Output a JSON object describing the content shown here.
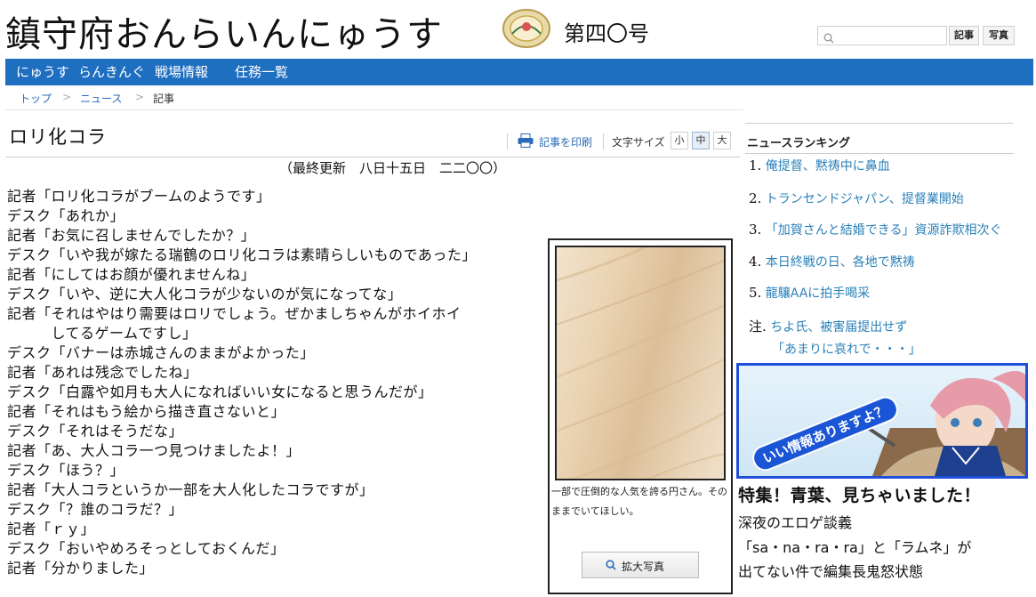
{
  "header": {
    "title": "鎮守府おんらいんにゅうす",
    "issue": "第四〇号",
    "search": {
      "placeholder": "",
      "articles_label": "記事",
      "photos_label": "写真"
    }
  },
  "nav": {
    "items": [
      "にゅうす",
      "らんきんぐ",
      "戦場情報",
      "任務一覧"
    ]
  },
  "breadcrumb": {
    "home": "トップ",
    "news": "ニュース",
    "current": "記事",
    "separator": ">"
  },
  "article": {
    "title": "ロリ化コラ",
    "print_label": "記事を印刷",
    "font_size_label": "文字サイズ",
    "font_sizes": [
      "小",
      "中",
      "大"
    ],
    "font_size_selected": "中",
    "updated": "（最終更新　八日十五日　二二〇〇）",
    "lines": [
      "記者「ロリ化コラがブームのようです」",
      "デスク「あれか」",
      "記者「お気に召しませんでしたか？」",
      "デスク「いや我が嫁たる瑞鶴のロリ化コラは素晴らしいものであった」",
      "記者「にしてはお顔が優れませんね」",
      "デスク「いや、逆に大人化コラが少ないのが気になってな」",
      "記者「それはやはり需要はロリでしょう。ぜかましちゃんがホイホイ",
      "　　　してるゲームですし」",
      "デスク「バナーは赤城さんのままがよかった」",
      "記者「あれは残念でしたね」",
      "デスク「白露や如月も大人になればいい女になると思うんだが」",
      "記者「それはもう絵から描き直さないと」",
      "デスク「それはそうだな」",
      "記者「あ、大人コラ一つ見つけましたよ！」",
      "デスク「ほう？」",
      "記者「大人コラというか一部を大人化したコラですが」",
      "デスク「？誰のコラだ？」",
      "記者「ｒｙ」",
      "デスク「おいやめろそっとしておくんだ」",
      "記者「分かりました」"
    ]
  },
  "photo": {
    "caption": "一部で圧倒的な人気を誇る円さん。そのままでいてほしい。",
    "enlarge_label": "拡大写真"
  },
  "ranking": {
    "title": "ニュースランキング",
    "items": [
      {
        "num": "1.",
        "text": "俺提督、黙祷中に鼻血"
      },
      {
        "num": "2.",
        "text": "トランセンドジャパン、提督業開始"
      },
      {
        "num": "3.",
        "text": "「加賀さんと結婚できる」資源詐欺相次ぐ"
      },
      {
        "num": "4.",
        "text": "本日終戦の日、各地で黙祷"
      },
      {
        "num": "5.",
        "text": "龍驤AAに拍手喝采"
      },
      {
        "num": "注.",
        "text": "ちよ氏、被害届提出せず"
      }
    ],
    "note_sub": "「あまりに哀れで・・・」"
  },
  "banner": {
    "text": "いい情報ありますよ？"
  },
  "feature": {
    "title": "特集！青葉、見ちゃいました！",
    "line1": "深夜のエロゲ談義",
    "line2": "「sa・na・ra・ra」と「ラムネ」が",
    "line3": "出てない件で編集長鬼怒状態"
  },
  "colors": {
    "nav_bg": "#1f6fc1",
    "link": "#2a80b9",
    "banner_border": "#1f4fd8"
  }
}
